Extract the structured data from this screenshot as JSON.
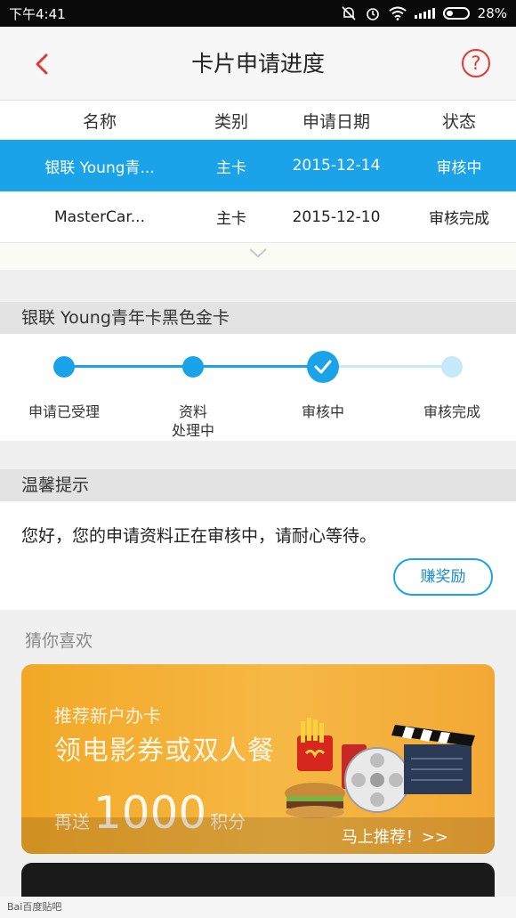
{
  "status_bar": {
    "time": "下午4:41",
    "battery": "28%"
  },
  "nav": {
    "title": "卡片申请进度",
    "help_glyph": "?"
  },
  "table": {
    "headers": [
      "名称",
      "类别",
      "申请日期",
      "状态"
    ],
    "rows": [
      {
        "name": "银联 Young青...",
        "type": "主卡",
        "date": "2015-12-14",
        "status": "审核中"
      },
      {
        "name": "MasterCar...",
        "type": "主卡",
        "date": "2015-12-10",
        "status": "审核完成"
      }
    ]
  },
  "card": {
    "title": "银联 Young青年卡黑色金卡",
    "steps": [
      {
        "label": "申请已受理",
        "state": "done"
      },
      {
        "label": "资料",
        "label2": "处理中",
        "state": "done"
      },
      {
        "label": "审核中",
        "state": "current"
      },
      {
        "label": "审核完成",
        "state": "pending"
      }
    ]
  },
  "tip": {
    "title": "温馨提示",
    "message": "您好，您的申请资料正在审核中，请耐心等待。",
    "reward_button": "赚奖励"
  },
  "recommend": {
    "title": "猜你喜欢",
    "banner": {
      "subtitle": "推荐新户办卡",
      "headline": "领电影券或双人餐",
      "bonus_prefix": "再送",
      "bonus_number": "1000",
      "bonus_suffix": "积分",
      "cta": "马上推荐！>>"
    }
  },
  "colors": {
    "accent": "#1aa3e8",
    "alert": "#e53935",
    "banner": "#f4ae33"
  },
  "watermark": "Bai百度贴吧"
}
